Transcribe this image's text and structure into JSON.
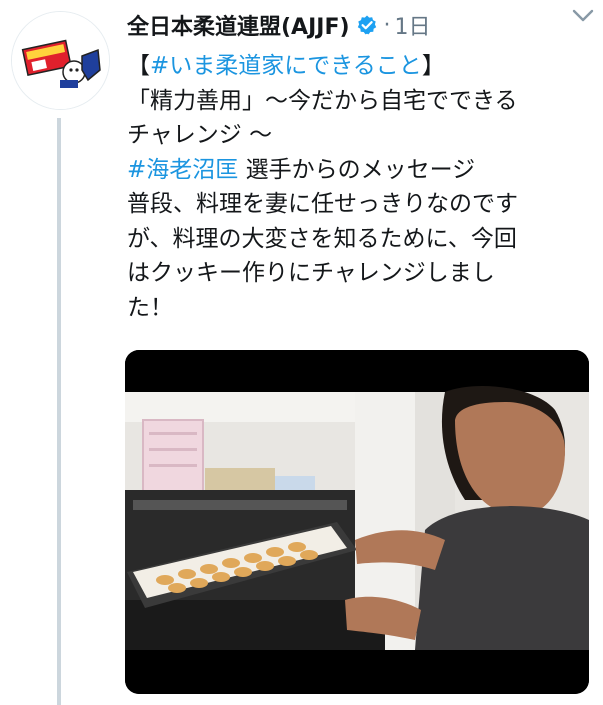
{
  "tweet": {
    "account_name": "全日本柔道連盟(AJJF)",
    "separator": "·",
    "timestamp": "1日",
    "lines": [
      {
        "type": "hashtag_bracket",
        "open": "【",
        "hashtag": "#いま柔道家にできること",
        "close": "】"
      },
      {
        "type": "plain",
        "text": "「精力善用」〜今だから自宅でできる"
      },
      {
        "type": "plain",
        "text": "チャレンジ 〜"
      },
      {
        "type": "hashtag_text",
        "hashtag": "#海老沼匡",
        "text": " 選手からのメッセージ"
      },
      {
        "type": "plain",
        "text": "普段、料理を妻に任せっきりなのです"
      },
      {
        "type": "plain",
        "text": "が、料理の大変さを知るために、今回"
      },
      {
        "type": "plain",
        "text": "はクッキー作りにチャレンジしまし"
      },
      {
        "type": "plain",
        "text": "た！"
      }
    ]
  },
  "icons": {
    "verified": "verified-badge-icon",
    "caret": "chevron-down-icon",
    "avatar": "ajjf-logo-avatar"
  },
  "colors": {
    "hashtag": "#1b95e0",
    "verified": "#1da1f2",
    "secondary_text": "#657786",
    "thread_line": "#ccd6dd"
  }
}
